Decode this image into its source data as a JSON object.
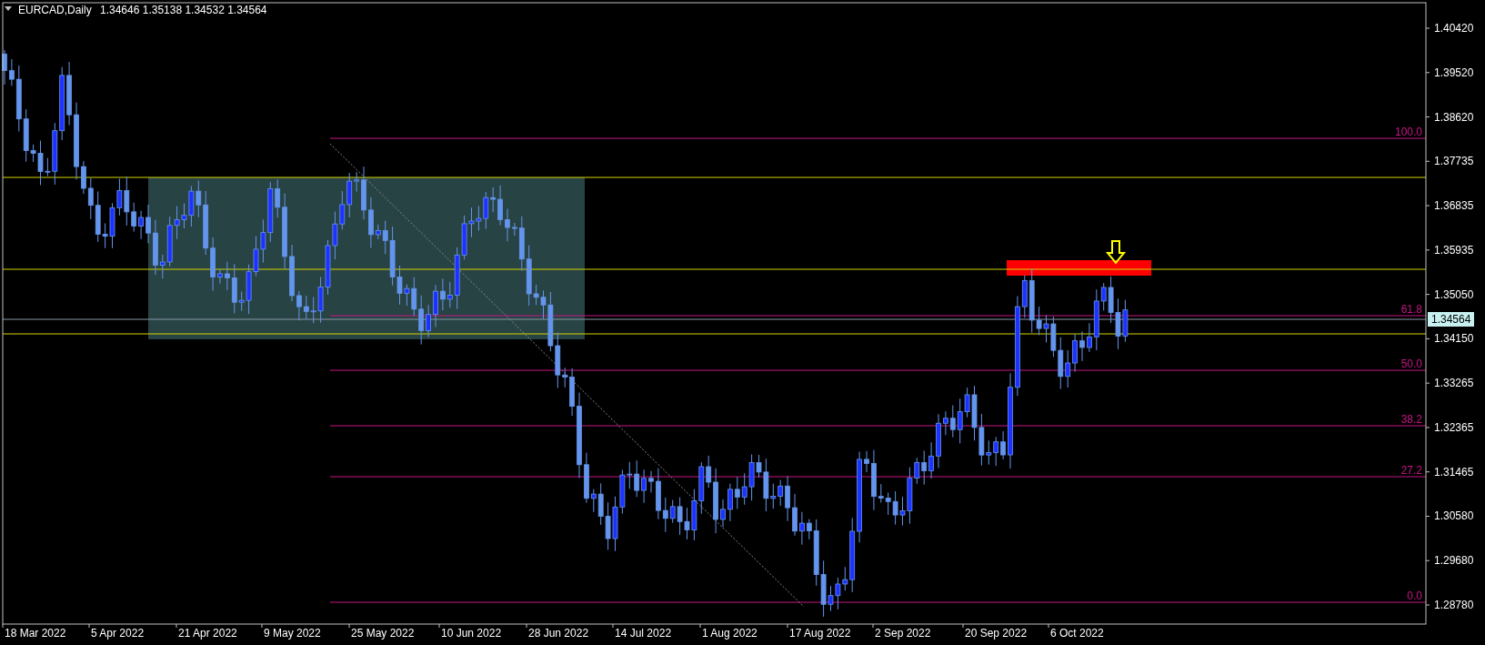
{
  "header": {
    "symbol": "EURCAD,Daily",
    "prices": [
      "1.34646",
      "1.35138",
      "1.34532",
      "1.34564"
    ]
  },
  "price_axis": [
    "1.40420",
    "1.39520",
    "1.38620",
    "1.37735",
    "1.36835",
    "1.35935",
    "1.35050",
    "1.34150",
    "1.33265",
    "1.32365",
    "1.31465",
    "1.30580",
    "1.29680",
    "1.28780"
  ],
  "current_price": "1.34564",
  "date_axis": [
    "18 Mar 2022",
    "5 Apr 2022",
    "21 Apr 2022",
    "9 May 2022",
    "25 May 2022",
    "10 Jun 2022",
    "28 Jun 2022",
    "14 Jul 2022",
    "1 Aug 2022",
    "17 Aug 2022",
    "2 Sep 2022",
    "20 Sep 2022",
    "6 Oct 2022"
  ],
  "fibonacci_levels": [
    "100.0",
    "61.8",
    "50.0",
    "38.2",
    "27.2",
    "0.0"
  ]
}
